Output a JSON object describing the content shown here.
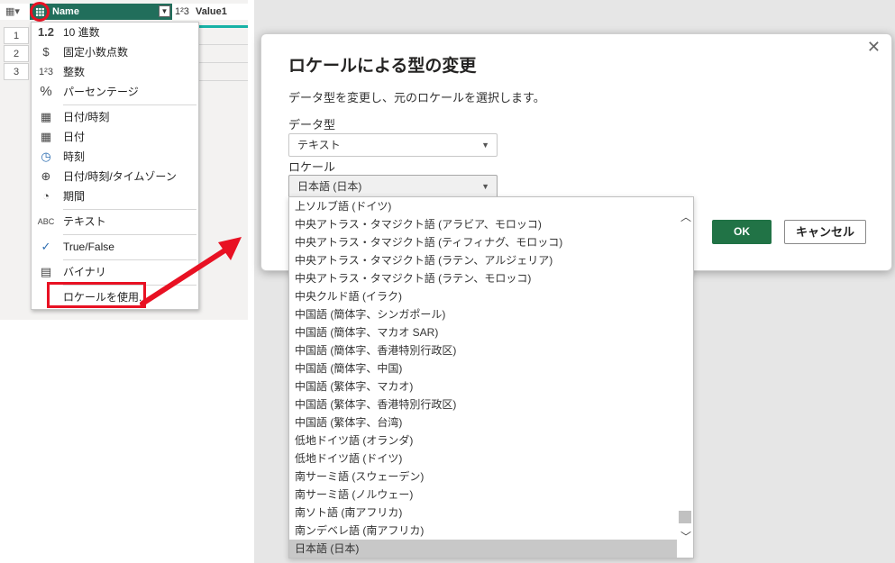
{
  "grid": {
    "columns": {
      "name": "Name",
      "value1": "Value1",
      "value1_type": "1²3"
    },
    "rows": [
      "1",
      "2",
      "3"
    ]
  },
  "type_menu": {
    "items": [
      {
        "icon": "1.2",
        "label": "10 進数"
      },
      {
        "icon": "$",
        "label": "固定小数点数"
      },
      {
        "icon": "1²3",
        "label": "整数"
      },
      {
        "icon": "%",
        "label": "パーセンテージ"
      },
      {
        "icon": "▦",
        "label": "日付/時刻"
      },
      {
        "icon": "▦",
        "label": "日付"
      },
      {
        "icon": "◷",
        "label": "時刻"
      },
      {
        "icon": "⊕",
        "label": "日付/時刻/タイムゾーン"
      },
      {
        "icon": "◔",
        "label": "期間"
      },
      {
        "icon": "ABC",
        "label": "テキスト"
      },
      {
        "icon": "✓",
        "label": "True/False"
      },
      {
        "icon": "▤",
        "label": "バイナリ"
      },
      {
        "icon": "",
        "label": "ロケールを使用..."
      }
    ]
  },
  "dialog": {
    "title": "ロケールによる型の変更",
    "description": "データ型を変更し、元のロケールを選択します。",
    "data_type_label": "データ型",
    "data_type_value": "テキスト",
    "locale_label": "ロケール",
    "locale_value": "日本語 (日本)",
    "ok_label": "OK",
    "cancel_label": "キャンセル",
    "close_glyph": "✕"
  },
  "locale_list": {
    "options": [
      "上ソルブ語 (ドイツ)",
      "中央アトラス・タマジクト語 (アラビア、モロッコ)",
      "中央アトラス・タマジクト語 (ティフィナグ、モロッコ)",
      "中央アトラス・タマジクト語 (ラテン、アルジェリア)",
      "中央アトラス・タマジクト語 (ラテン、モロッコ)",
      "中央クルド語 (イラク)",
      "中国語 (簡体字、シンガポール)",
      "中国語 (簡体字、マカオ SAR)",
      "中国語 (簡体字、香港特別行政区)",
      "中国語 (簡体字、中国)",
      "中国語 (繁体字、マカオ)",
      "中国語 (繁体字、香港特別行政区)",
      "中国語 (繁体字、台湾)",
      "低地ドイツ語 (オランダ)",
      "低地ドイツ語 (ドイツ)",
      "南サーミ語 (スウェーデン)",
      "南サーミ語 (ノルウェー)",
      "南ソト語 (南アフリカ)",
      "南ンデベレ語 (南アフリカ)",
      "日本語 (日本)"
    ],
    "selected": "日本語 (日本)"
  },
  "colors": {
    "header_green": "#216e5b",
    "ok_green": "#217346",
    "highlight_red": "#e81123",
    "teal": "#17b2a6"
  }
}
